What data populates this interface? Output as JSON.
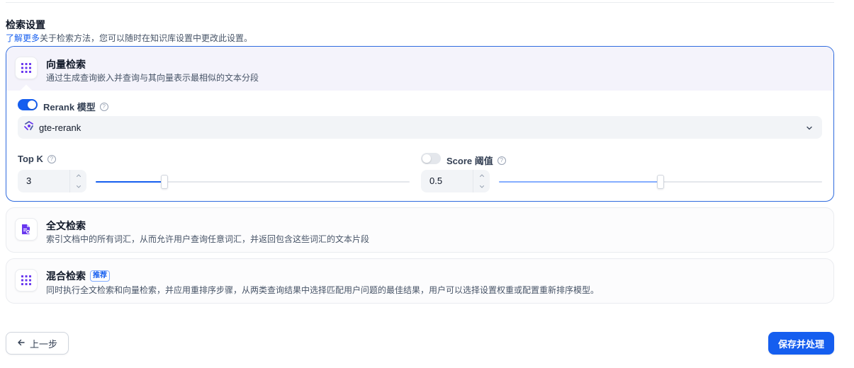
{
  "section": {
    "title": "检索设置",
    "learn_more": "了解更多",
    "description": "关于检索方法，您可以随时在知识库设置中更改此设置。"
  },
  "vector_search": {
    "title": "向量检索",
    "description": "通过生成查询嵌入并查询与其向量表示最相似的文本分段",
    "rerank": {
      "enabled": true,
      "label": "Rerank 模型",
      "help_glyph": "?",
      "model": "gte-rerank"
    },
    "top_k": {
      "label": "Top K",
      "help_glyph": "?",
      "value": "3",
      "slider_fraction": 0.22
    },
    "score_threshold": {
      "enabled": false,
      "label": "Score 阈值",
      "help_glyph": "?",
      "value": "0.5",
      "slider_fraction": 0.5
    }
  },
  "full_text_search": {
    "title": "全文检索",
    "description": "索引文档中的所有词汇，从而允许用户查询任意词汇，并返回包含这些词汇的文本片段"
  },
  "hybrid_search": {
    "title": "混合检索",
    "badge": "推荐",
    "description": "同时执行全文检索和向量检索，并应用重排序步骤，从两类查询结果中选择匹配用户问题的最佳结果，用户可以选择设置权重或配置重新排序模型。"
  },
  "footer": {
    "back_label": "上一步",
    "save_label": "保存并处理"
  },
  "colors": {
    "accent": "#155eef",
    "icon_purple": "#6938ef"
  },
  "icons": {
    "vector": "grid-dots-icon",
    "full_text": "document-search-icon",
    "hybrid": "grid-dots-icon",
    "model": "model-provider-icon",
    "back": "arrow-left-icon",
    "select": "chevron-down-icon"
  }
}
